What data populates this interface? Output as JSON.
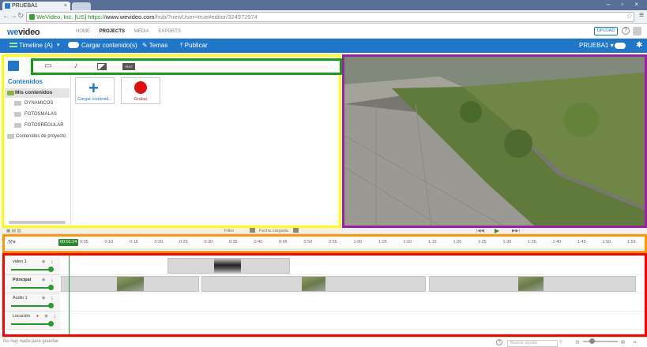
{
  "browser": {
    "tab_title": "PRUEBA1",
    "tab_close": "×",
    "url_secure": "WeVideo, Inc. [US]",
    "url_scheme": "https://",
    "url_host": "www.wevideo.com",
    "url_path": "/hub/?newUser=true#editor/324972974",
    "window_controls": "– ▫ ×"
  },
  "app_header": {
    "logo_we": "we",
    "logo_video": "video",
    "nav": [
      "HOME",
      "PROJECTS",
      "MEDIA",
      "EXPORTS"
    ],
    "nav_active": "PROJECTS",
    "upload_label": "UPLOAD",
    "help_label": "?"
  },
  "toolbar": {
    "timeline_label": "Timeline (A)",
    "caret": "▾",
    "upload_content_label": "Cargar contenido(s)",
    "themes_label": "Temas",
    "publish_label": "Publicar",
    "user_label": "PRUEBA1 ▾",
    "accent": "#1e77c8"
  },
  "media_panel": {
    "tab_icons": [
      "folder-icon",
      "image-icon",
      "music-note-icon",
      "transition-icon",
      "text-icon"
    ],
    "text_tab_label": "TEXT",
    "title": "Contenidos",
    "root_folder": "Mis contenidos",
    "folders": [
      "DYNAMICOS",
      "FOTOSMALAS",
      "FOTOSREGULAR"
    ],
    "project_folder": "Contenidos de proyecto",
    "cards": [
      {
        "label": "Cargar contenid...",
        "icon": "plus-icon"
      },
      {
        "label": "Grabar",
        "icon": "record-icon"
      }
    ],
    "border_color": "#ffff00",
    "tabs_border_color": "#12a012"
  },
  "strip": {
    "filter_label": "Filtro",
    "date_label": "Fecha cargada"
  },
  "ruler": {
    "current_time": "00:01:24",
    "ticks": [
      "0:05",
      "0:10",
      "0:15",
      "0:20",
      "0:25",
      "0:30",
      "0:35",
      "0:40",
      "0:45",
      "0:50",
      "0:55",
      "1:00",
      "1:05",
      "1:10",
      "1:15",
      "1:20",
      "1:25",
      "1:30",
      "1:35",
      "1:40",
      "1:45",
      "1:50",
      "1:55"
    ]
  },
  "timeline": {
    "tracks": [
      {
        "name": "video 1"
      },
      {
        "name": "Principal"
      },
      {
        "name": "Audio 1"
      },
      {
        "name": "Locución"
      }
    ]
  },
  "status": {
    "message": "No hay nada para guardar",
    "search_placeholder": "Buscar ayuda"
  }
}
